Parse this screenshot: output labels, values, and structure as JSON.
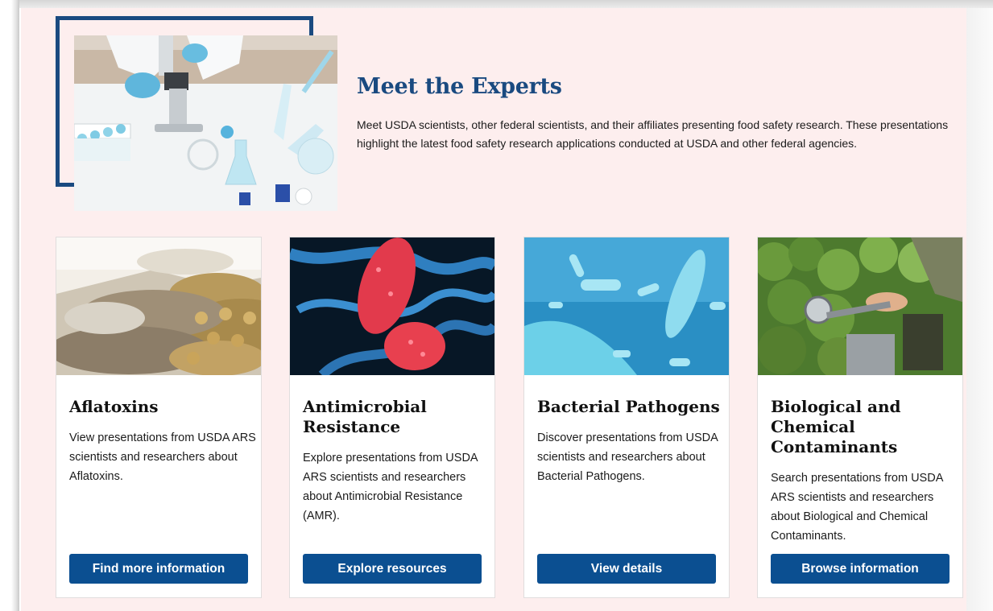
{
  "hero": {
    "title": "Meet the Experts",
    "description": "Meet USDA scientists, other federal scientists, and their affiliates presenting food safety research.  These presentations highlight the latest food safety research applications conducted at USDA and other federal agencies.",
    "image": "laboratory-microscope-photo"
  },
  "cards": [
    {
      "title": "Aflatoxins",
      "description": "View presentations from USDA ARS scientists and researchers about Aflatoxins.",
      "button": "Find more information",
      "image": "moldy-corn-photo"
    },
    {
      "title": "Antimicrobial Resistance",
      "description": "Explore presentations from USDA ARS scientists and researchers about Antimicrobial Resistance (AMR).",
      "button": "Explore resources",
      "image": "bacteria-micrograph"
    },
    {
      "title": "Bacterial Pathogens",
      "description": "Discover presentations from USDA scientists and researchers about Bacterial Pathogens.",
      "button": "View details",
      "image": "rod-bacteria-illustration"
    },
    {
      "title": "Biological and Chemical Contaminants",
      "description": "Search presentations from USDA ARS scientists and researchers about Biological and Chemical Contaminants.",
      "button": "Browse information",
      "image": "broccoli-inspection-photo"
    }
  ],
  "colors": {
    "brand_blue": "#1a4a80",
    "button_blue": "#0b4f91",
    "panel_background": "#fdeeee"
  }
}
